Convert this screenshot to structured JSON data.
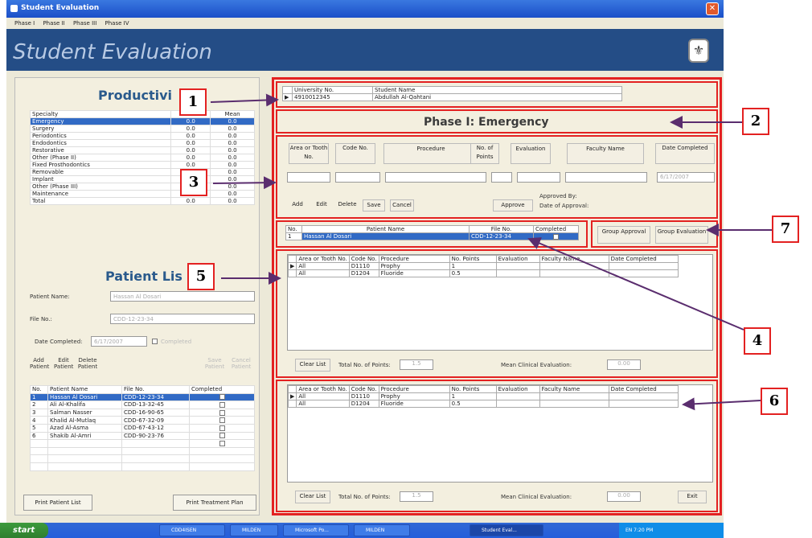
{
  "window": {
    "title": "Student Evaluation",
    "close_glyph": "✕"
  },
  "menu": [
    "Phase I",
    "Phase II",
    "Phase III",
    "Phase IV"
  ],
  "banner": {
    "title": "Student Evaluation"
  },
  "productivity": {
    "title": "Productivi",
    "headers": [
      "Specialty",
      "Total",
      "Mean"
    ],
    "rows": [
      {
        "s": "Emergency",
        "t": "0.0",
        "m": "0.0"
      },
      {
        "s": "Surgery",
        "t": "0.0",
        "m": "0.0"
      },
      {
        "s": "Periodontics",
        "t": "0.0",
        "m": "0.0"
      },
      {
        "s": "Endodontics",
        "t": "0.0",
        "m": "0.0"
      },
      {
        "s": "Restorative",
        "t": "0.0",
        "m": "0.0"
      },
      {
        "s": "Other (Phase II)",
        "t": "0.0",
        "m": "0.0"
      },
      {
        "s": "Fixed Prosthodontics",
        "t": "0.0",
        "m": "0.0"
      },
      {
        "s": "Removable",
        "t": "0.0",
        "m": "0.0"
      },
      {
        "s": "Implant",
        "t": "0.0",
        "m": "0.0"
      },
      {
        "s": "Other (Phase III)",
        "t": "0.0",
        "m": "0.0"
      },
      {
        "s": "Maintenance",
        "t": "0.0",
        "m": "0.0"
      },
      {
        "s": "Total",
        "t": "0.0",
        "m": "0.0"
      }
    ]
  },
  "patient_list": {
    "title": "Patient Lis",
    "name_label": "Patient Name:",
    "name_value": "Hassan Al Dosari",
    "file_label": "File No.:",
    "file_value": "CDD-12-23-34",
    "date_label": "Date Completed:",
    "date_value": "6/17/2007",
    "completed_label": "Completed",
    "buttons": [
      "Add Patient",
      "Edit Patient",
      "Delete Patient",
      "Save Patient",
      "Cancel Patient"
    ],
    "headers": [
      "No.",
      "Patient Name",
      "File No.",
      "Completed"
    ],
    "rows": [
      {
        "no": "1",
        "name": "Hassan Al Dosari",
        "file": "CDD-12-23-34"
      },
      {
        "no": "2",
        "name": "Ali Al-Khalifa",
        "file": "CDD-13-32-45"
      },
      {
        "no": "3",
        "name": "Salman Nasser",
        "file": "CDD-16-90-65"
      },
      {
        "no": "4",
        "name": "Khalid Al-Mutlaq",
        "file": "CDD-67-32-09"
      },
      {
        "no": "5",
        "name": "Azad Al-Asma",
        "file": "CDD-67-43-12"
      },
      {
        "no": "6",
        "name": "Shakib Al-Amri",
        "file": "CDD-90-23-76"
      }
    ],
    "print_patient_list": "Print Patient List",
    "print_treatment_plan": "Print Treatment Plan"
  },
  "student": {
    "headers": [
      "University No.",
      "Student Name"
    ],
    "university_no": "4910012345",
    "student_name": "Abdullah Al-Qahtani"
  },
  "phase_title": "Phase I: Emergency",
  "procedure_form": {
    "headers": [
      "Area or Tooth No.",
      "Code No.",
      "Procedure",
      "No. of Points",
      "Evaluation",
      "Faculty Name",
      "Date Completed"
    ],
    "date_value": "6/17/2007",
    "buttons": [
      "Add",
      "Edit",
      "Delete",
      "Save",
      "Cancel"
    ],
    "approve_button": "Approve",
    "approved_by": "Approved By:",
    "date_of_approval": "Date of Approval:"
  },
  "selected_patient": {
    "headers": [
      "No.",
      "Patient Name",
      "File No.",
      "Completed"
    ],
    "no": "1",
    "name": "Hassan Al Dosari",
    "file": "CDD-12-23-34"
  },
  "group_buttons": [
    "Group Approval",
    "Group Evaluation"
  ],
  "grid_headers": [
    "Area or Tooth No.",
    "Code No.",
    "Procedure",
    "No. Points",
    "Evaluation",
    "Faculty Name",
    "Date Completed"
  ],
  "grid_upper": [
    {
      "area": "All",
      "code": "D1110",
      "proc": "Prophy",
      "pts": "1"
    },
    {
      "area": "All",
      "code": "D1204",
      "proc": "Fluoride",
      "pts": "0.5"
    }
  ],
  "grid_lower": [
    {
      "area": "All",
      "code": "D1110",
      "proc": "Prophy",
      "pts": "1"
    },
    {
      "area": "All",
      "code": "D1204",
      "proc": "Fluoride",
      "pts": "0.5"
    }
  ],
  "summary": {
    "clear_list": "Clear List",
    "total_points_label": "Total No. of Points:",
    "total_points_value": "1.5",
    "mean_label": "Mean Clinical Evaluation:",
    "mean_value": "0.00",
    "exit": "Exit"
  },
  "callouts": [
    "1",
    "2",
    "3",
    "4",
    "5",
    "6",
    "7"
  ],
  "taskbar": {
    "start": "start",
    "items": [
      "CDD4ISEN",
      "MILDEN",
      "Microsoft Po...",
      "MILDEN",
      "Student Eval..."
    ],
    "tray": "EN  7:20 PM"
  },
  "colors": {
    "banner": "#244d86",
    "highlight_box": "#e32121",
    "selection": "#316ac5",
    "callout_arrow": "#5a2d6e"
  }
}
